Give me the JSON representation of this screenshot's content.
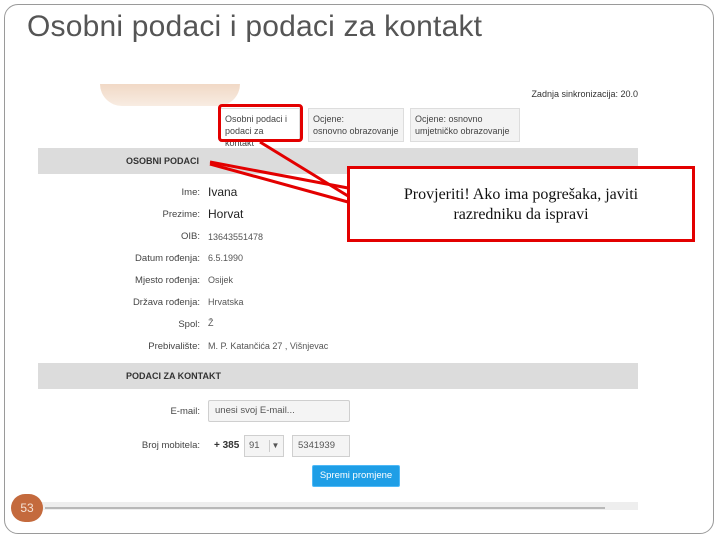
{
  "slide": {
    "title": "Osobni podaci i podaci za kontakt",
    "page_number": "53"
  },
  "app": {
    "sync_text": "Zadnja sinkronizacija: 20.0",
    "tabs": [
      {
        "line1": "Osobni podaci i",
        "line2": "podaci za kontakt",
        "active": true
      },
      {
        "line1": "Ocjene:",
        "line2": "osnovno obrazovanje",
        "active": false
      },
      {
        "line1": "Ocjene: osnovno",
        "line2": "umjetničko obrazovanje",
        "active": false
      }
    ],
    "section_personal": "OSOBNI PODACI",
    "fields": [
      {
        "label": "Ime:",
        "value": "Ivana"
      },
      {
        "label": "Prezime:",
        "value": "Horvat"
      },
      {
        "label": "OIB:",
        "value": "13643551478"
      },
      {
        "label": "Datum rođenja:",
        "value": "6.5.1990"
      },
      {
        "label": "Mjesto rođenja:",
        "value": "Osijek"
      },
      {
        "label": "Država rođenja:",
        "value": "Hrvatska"
      },
      {
        "label": "Spol:",
        "value": "Ž"
      },
      {
        "label": "Prebivalište:",
        "value": "M. P. Katančića 27 ,    Višnjevac"
      }
    ],
    "section_contact": "PODACI ZA KONTAKT",
    "email": {
      "label": "E-mail:",
      "placeholder": "unesi svoj E-mail..."
    },
    "phone": {
      "label": "Broj mobitela:",
      "prefix": "+ 385",
      "operator": "91",
      "number": "5341939"
    },
    "save_label": "Spremi promjene"
  },
  "note": {
    "text_line1": "Provjeriti! Ako ima pogrešaka, javiti",
    "text_line2": "razredniku da ispravi"
  },
  "colors": {
    "highlight": "#e30000",
    "save_button": "#1e9ee6",
    "section_band": "#dcdcdc",
    "page_badge": "#c46a3d"
  }
}
